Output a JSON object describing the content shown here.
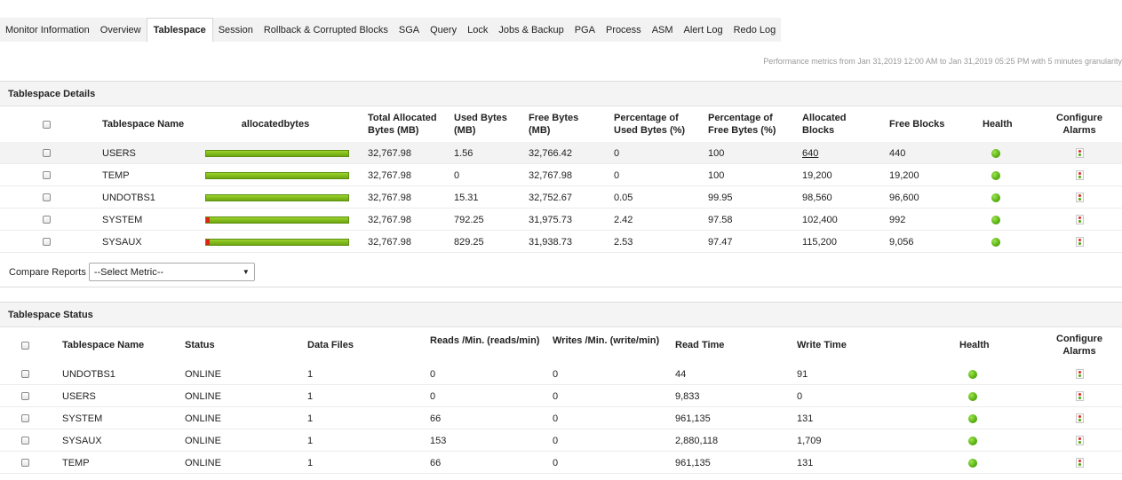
{
  "tabs": [
    "Monitor Information",
    "Overview",
    "Tablespace",
    "Session",
    "Rollback & Corrupted Blocks",
    "SGA",
    "Query",
    "Lock",
    "Jobs & Backup",
    "PGA",
    "Process",
    "ASM",
    "Alert Log",
    "Redo Log"
  ],
  "active_tab": "Tablespace",
  "perf_note": "Performance metrics from Jan 31,2019 12:00 AM to Jan 31,2019 05:25 PM with 5 minutes granularity",
  "details": {
    "title": "Tablespace Details",
    "headers": {
      "name": "Tablespace Name",
      "allocated": "allocatedbytes",
      "total": [
        "Total Allocated",
        "Bytes  (MB)"
      ],
      "used": [
        "Used Bytes",
        "(MB)"
      ],
      "free": [
        "Free Bytes",
        "(MB)"
      ],
      "pct_used": [
        "Percentage of",
        "Used Bytes  (%)"
      ],
      "pct_free": [
        "Percentage of",
        "Free Bytes  (%)"
      ],
      "alloc_blocks": [
        "Allocated",
        "Blocks"
      ],
      "free_blocks": "Free Blocks",
      "health": "Health",
      "configure": [
        "Configure",
        "Alarms"
      ]
    },
    "rows": [
      {
        "name": "USERS",
        "used_fraction": 0.0,
        "total": "32,767.98",
        "used": "1.56",
        "free": "32,766.42",
        "pct_used": "0",
        "pct_free": "100",
        "alloc_blocks": "640",
        "free_blocks": "440",
        "health": "green"
      },
      {
        "name": "TEMP",
        "used_fraction": 0.0,
        "total": "32,767.98",
        "used": "0",
        "free": "32,767.98",
        "pct_used": "0",
        "pct_free": "100",
        "alloc_blocks": "19,200",
        "free_blocks": "19,200",
        "health": "green"
      },
      {
        "name": "UNDOTBS1",
        "used_fraction": 0.0,
        "total": "32,767.98",
        "used": "15.31",
        "free": "32,752.67",
        "pct_used": "0.05",
        "pct_free": "99.95",
        "alloc_blocks": "98,560",
        "free_blocks": "96,600",
        "health": "green"
      },
      {
        "name": "SYSTEM",
        "used_fraction": 0.0242,
        "total": "32,767.98",
        "used": "792.25",
        "free": "31,975.73",
        "pct_used": "2.42",
        "pct_free": "97.58",
        "alloc_blocks": "102,400",
        "free_blocks": "992",
        "health": "green"
      },
      {
        "name": "SYSAUX",
        "used_fraction": 0.0253,
        "total": "32,767.98",
        "used": "829.25",
        "free": "31,938.73",
        "pct_used": "2.53",
        "pct_free": "97.47",
        "alloc_blocks": "115,200",
        "free_blocks": "9,056",
        "health": "green"
      }
    ]
  },
  "compare": {
    "label": "Compare Reports",
    "selected": "--Select Metric--"
  },
  "status": {
    "title": "Tablespace Status",
    "headers": {
      "name": "Tablespace Name",
      "status": "Status",
      "data_files": "Data Files",
      "reads": "Reads /Min.  (reads/min)",
      "writes": "Writes /Min.  (write/min)",
      "read_time": "Read Time",
      "write_time": "Write Time",
      "health": "Health",
      "configure": [
        "Configure",
        "Alarms"
      ]
    },
    "rows": [
      {
        "name": "UNDOTBS1",
        "status": "ONLINE",
        "data_files": "1",
        "reads": "0",
        "writes": "0",
        "read_time": "44",
        "write_time": "91",
        "health": "green"
      },
      {
        "name": "USERS",
        "status": "ONLINE",
        "data_files": "1",
        "reads": "0",
        "writes": "0",
        "read_time": "9,833",
        "write_time": "0",
        "health": "green"
      },
      {
        "name": "SYSTEM",
        "status": "ONLINE",
        "data_files": "1",
        "reads": "66",
        "writes": "0",
        "read_time": "961,135",
        "write_time": "131",
        "health": "green"
      },
      {
        "name": "SYSAUX",
        "status": "ONLINE",
        "data_files": "1",
        "reads": "153",
        "writes": "0",
        "read_time": "2,880,118",
        "write_time": "1,709",
        "health": "green"
      },
      {
        "name": "TEMP",
        "status": "ONLINE",
        "data_files": "1",
        "reads": "66",
        "writes": "0",
        "read_time": "961,135",
        "write_time": "131",
        "health": "green"
      }
    ]
  },
  "colors": {
    "health_green": "#4fa60a",
    "bar_green": "#7cbb18",
    "bar_used_red": "#e2231a"
  },
  "icons": {
    "health": "health-status-icon",
    "alarm": "configure-alarm-icon",
    "dropdown": "chevron-down-icon"
  }
}
